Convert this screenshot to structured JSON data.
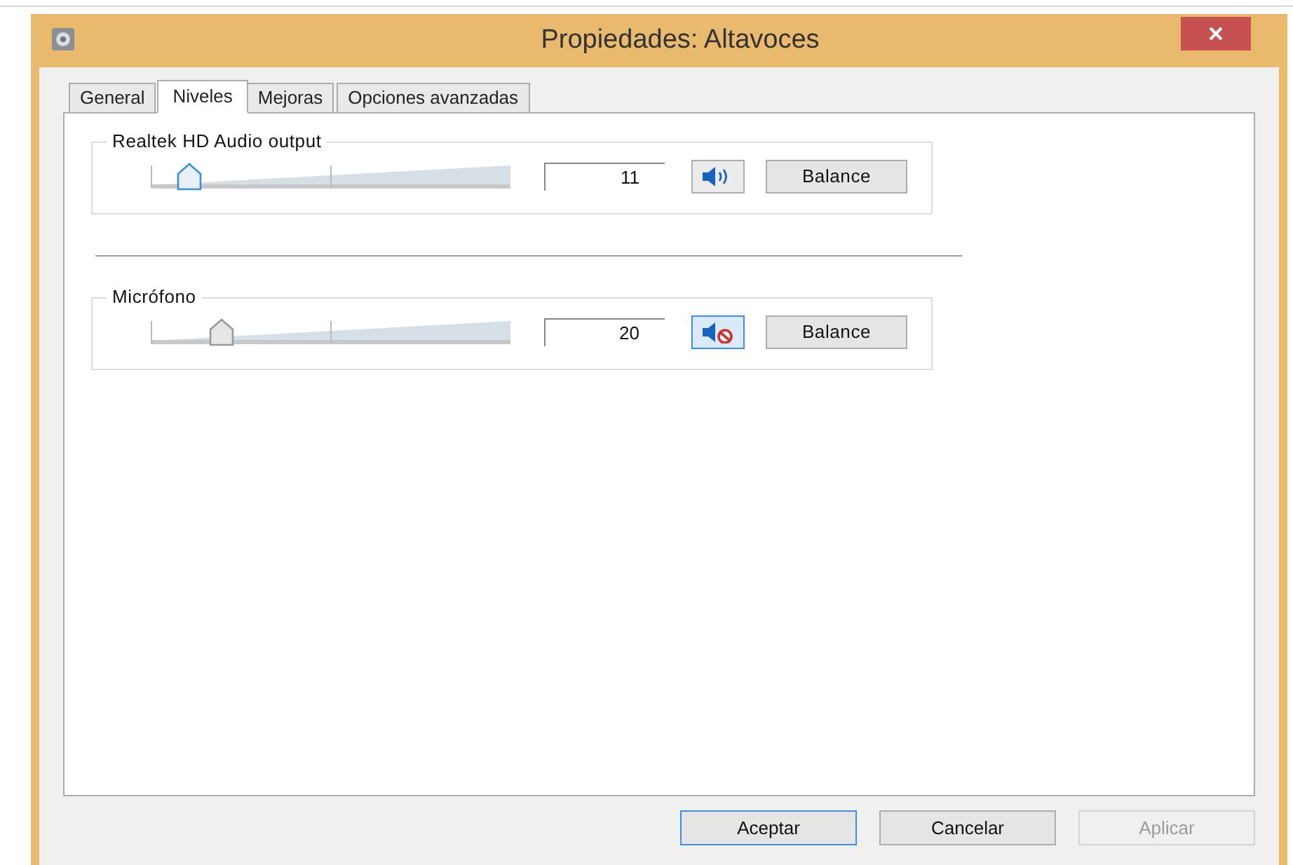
{
  "window": {
    "title": "Propiedades: Altavoces"
  },
  "tabs": [
    {
      "label": "General",
      "selected": false
    },
    {
      "label": "Niveles",
      "selected": true
    },
    {
      "label": "Mejoras",
      "selected": false
    },
    {
      "label": "Opciones avanzadas",
      "selected": false
    }
  ],
  "channels": [
    {
      "name": "Realtek HD Audio output",
      "level": 0.11,
      "reading": "11",
      "muted": false,
      "focused": true,
      "balance": "Balance"
    },
    {
      "name": "Micrófono",
      "level": 0.2,
      "reading": "20",
      "muted": true,
      "focused": false,
      "balance": "Balance"
    }
  ],
  "buttons": [
    {
      "label": "Aceptar",
      "kind": "default"
    },
    {
      "label": "Cancelar",
      "kind": "normal"
    },
    {
      "label": "Aplicar",
      "kind": "disabled"
    }
  ]
}
